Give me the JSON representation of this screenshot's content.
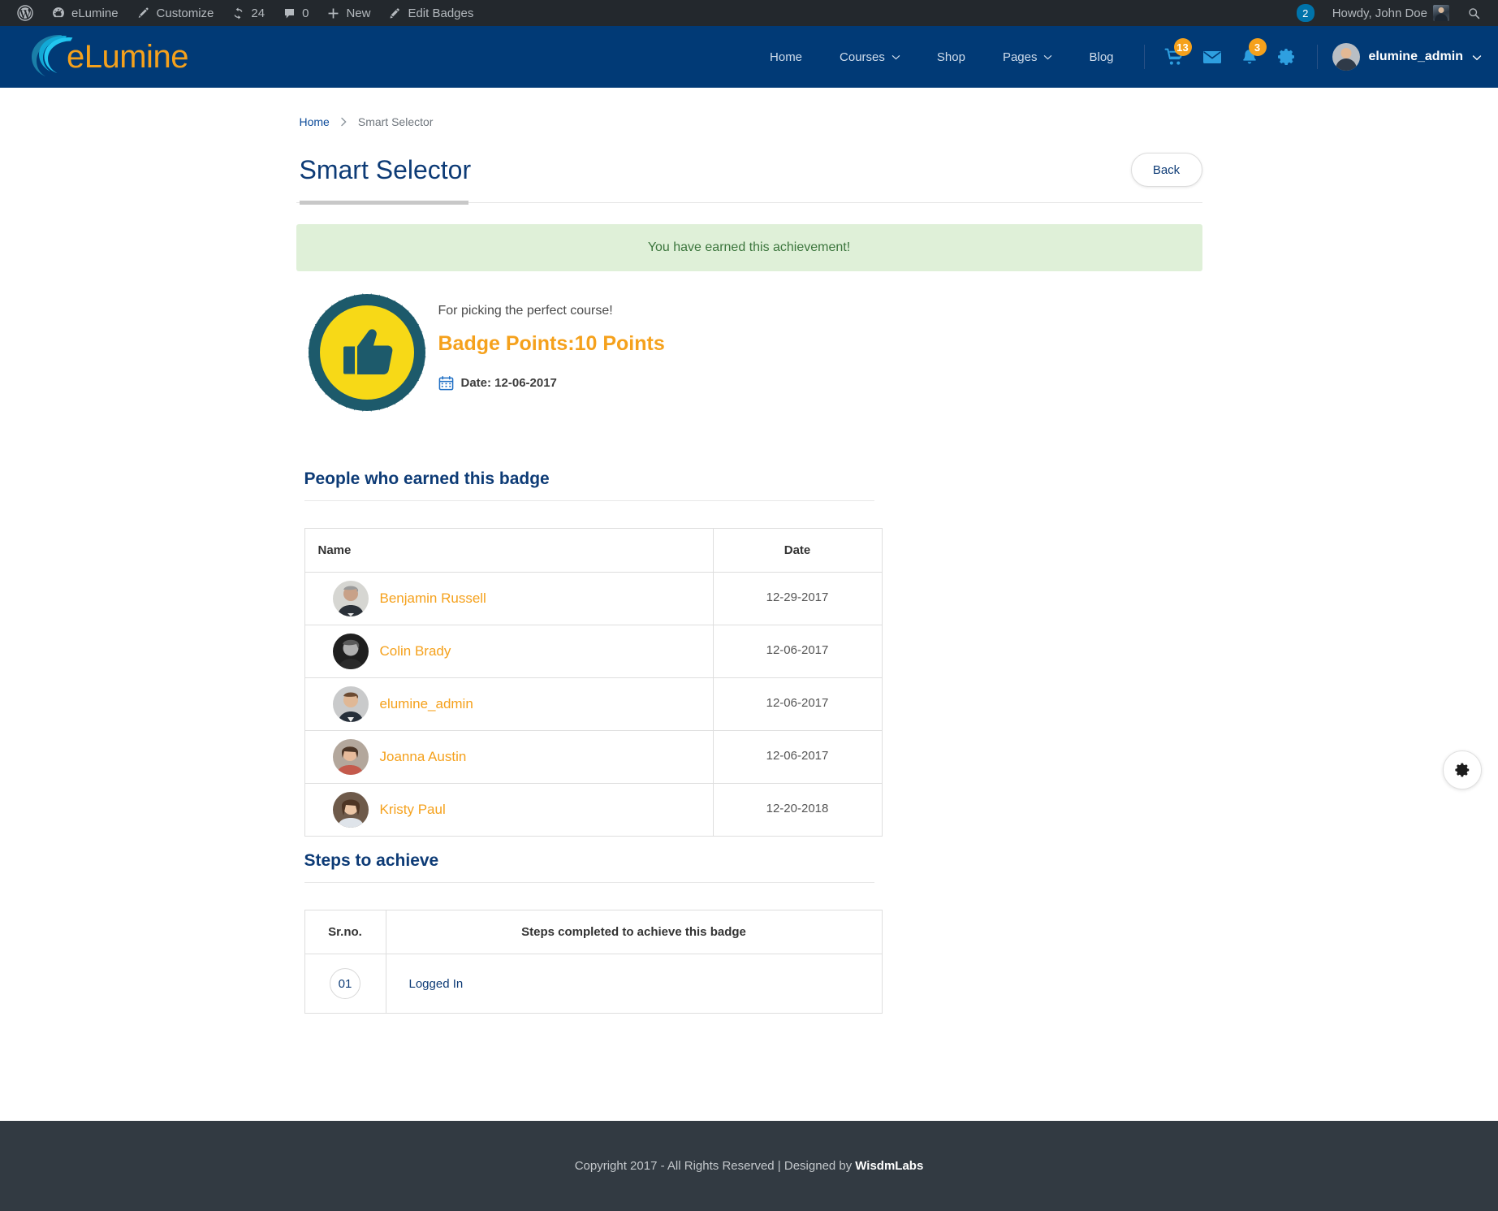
{
  "adminbar": {
    "wp_logo": "wordpress-icon",
    "site_name": "eLumine",
    "customize": "Customize",
    "updates_count": "24",
    "comments_count": "0",
    "new_label": "New",
    "edit_badges": "Edit Badges",
    "notifications_count": "2",
    "howdy": "Howdy, John Doe",
    "search": "search-icon"
  },
  "nav": {
    "brand": "eLumine",
    "links": [
      {
        "label": "Home",
        "dropdown": false
      },
      {
        "label": "Courses",
        "dropdown": true
      },
      {
        "label": "Shop",
        "dropdown": false
      },
      {
        "label": "Pages",
        "dropdown": true
      },
      {
        "label": "Blog",
        "dropdown": false
      }
    ],
    "cart_count": "13",
    "bell_count": "3",
    "username": "elumine_admin"
  },
  "breadcrumb": {
    "home": "Home",
    "separator": "›",
    "current": "Smart Selector"
  },
  "header": {
    "title": "Smart Selector",
    "back_label": "Back"
  },
  "alert": {
    "message": "You have earned this achievement!"
  },
  "badge": {
    "description": "For picking the perfect course!",
    "points_label": "Badge Points:",
    "points_value": "10 Points",
    "date_label": "Date: 12-06-2017",
    "icon": "thumbs-up-badge"
  },
  "people": {
    "section_title": "People who earned this badge",
    "columns": {
      "name": "Name",
      "date": "Date"
    },
    "rows": [
      {
        "name": "Benjamin Russell",
        "date": "12-29-2017",
        "skin": "#c8a188",
        "hair": "#9a9a9a",
        "bg": "#d6d6d2",
        "suit": "#2a3038"
      },
      {
        "name": "Colin Brady",
        "date": "12-06-2017",
        "skin": "#b0b0b0",
        "hair": "#5a5a5a",
        "bg": "#1f1f1f",
        "suit": "#2b2b2b"
      },
      {
        "name": "elumine_admin",
        "date": "12-06-2017",
        "skin": "#e0b896",
        "hair": "#6b4a32",
        "bg": "#c9cacb",
        "suit": "#262f3a"
      },
      {
        "name": "Joanna Austin",
        "date": "12-06-2017",
        "skin": "#e7bb9b",
        "hair": "#4b3526",
        "bg": "#b3a79c",
        "suit": "#c45a4c"
      },
      {
        "name": "Kristy Paul",
        "date": "12-20-2018",
        "skin": "#ecc6a6",
        "hair": "#4e3524",
        "bg": "#6e5a4a",
        "suit": "#dfe4ea"
      }
    ]
  },
  "steps": {
    "section_title": "Steps to achieve",
    "columns": {
      "sr": "Sr.no.",
      "step": "Steps completed to achieve this badge"
    },
    "rows": [
      {
        "sr": "01",
        "step": "Logged In"
      }
    ]
  },
  "float_button": {
    "icon": "gear-icon"
  },
  "footer": {
    "text": "Copyright 2017 - All Rights Reserved | Designed by ",
    "brand": "WisdmLabs"
  },
  "colors": {
    "nav_blue": "#013a76",
    "accent_orange": "#f5a11c",
    "title_blue": "#0d3b76",
    "success_bg": "#dff0d8",
    "success_text": "#3c763d",
    "footer_bg": "#323a42",
    "admin_bar": "#23282d"
  }
}
